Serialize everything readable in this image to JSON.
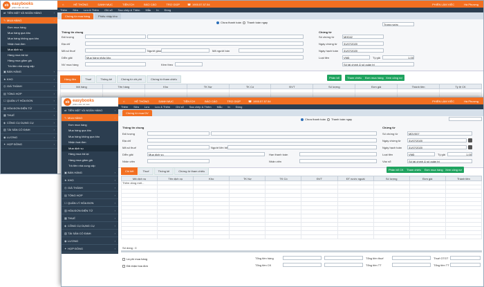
{
  "brand": {
    "logo_letters": "eb",
    "name": "easybooks",
    "tagline": "phần mềm kế toán"
  },
  "topmenu": {
    "items": [
      "HỆ THỐNG",
      "DANH MỤC",
      "TIỆN ÍCH",
      "BÁO CÁO",
      "TRỢ GIÚP"
    ],
    "phone": "1900.57.57.54",
    "session": "PHIÊN LÀM VIỆC",
    "user": "Hà Phương"
  },
  "sidebar": {
    "items": [
      {
        "label": "TIỀN MẶT VÀ NGÂN HÀNG"
      },
      {
        "label": "MUA HÀNG",
        "active": true
      },
      {
        "label": "BÁN HÀNG"
      },
      {
        "label": "KHO"
      },
      {
        "label": "GIÁ THÀNH"
      },
      {
        "label": "TỔNG HỢP"
      },
      {
        "label": "QUẢN LÝ HÓA ĐƠN"
      },
      {
        "label": "HÓA ĐƠN ĐIỆN TỬ"
      },
      {
        "label": "THUẾ"
      },
      {
        "label": "CÔNG CỤ DỤNG CỤ"
      },
      {
        "label": "TÀI SẢN CỐ ĐỊNH"
      },
      {
        "label": "LƯƠNG"
      },
      {
        "label": "HỢP ĐỒNG"
      }
    ],
    "sub": [
      "Đơn mua hàng",
      "Mua hàng qua kho",
      "Mua hàng không qua kho",
      "Nhận hoá đơn",
      "Mua dịch vụ",
      "Hàng mua trả lại",
      "Hàng mua giảm giá",
      "Trả tiền nhà cung cấp"
    ]
  },
  "w1": {
    "toolbar": [
      "Thêm",
      "Sửa",
      "Lưu & Thêm",
      "Ghi sổ",
      "Sao chép & Thêm",
      "Mẫu",
      "In",
      "Đóng"
    ],
    "tabs": [
      "Chứng từ mua hàng",
      "Phiếu nhập kho"
    ],
    "radios": [
      "Chưa thanh toán",
      "Thanh toán ngay"
    ],
    "form": {
      "title": "Thông tin chung",
      "labels": [
        "Đối tượng",
        "Địa chỉ",
        "Mã số thuế",
        "Diễn giải",
        "NV mua hàng"
      ],
      "contact": "Người giao",
      "person": "Kèm theo",
      "desc": "Mua hàng nhập kho",
      "vat": "Mã người bán"
    },
    "voucher": {
      "title": "Chứng từ",
      "fields": [
        {
          "label": "Số chứng từ",
          "value": "MH042"
        },
        {
          "label": "Ngày chứng từ",
          "value": "31/07/2020"
        },
        {
          "label": "Ngày hạch toán",
          "value": "31/07/2020"
        }
      ],
      "currency_label": "Loại tiền",
      "currency": "VNĐ",
      "rate_label": "Tỷ giá",
      "rate": "1.00",
      "doc_type": "Trong nước",
      "debt": "Số tài chính & số quản trị"
    },
    "dtabs": [
      "Hàng tiền",
      "Thuế",
      "Thống kê",
      "Chứng từ chi phí",
      "Chứng từ tham chiếu"
    ],
    "buttons": [
      "Phân bổ",
      "Tham chiếu",
      "Đơn mua hàng",
      "Xem công nợ"
    ],
    "cols": [
      "Mã hàng",
      "Tên hàng",
      "Kho",
      "TK Nợ",
      "TK Có",
      "ĐVT",
      "Số lượng",
      "Đơn giá",
      "Thành tiền",
      "Tỷ lệ CK"
    ]
  },
  "w2": {
    "toolbar": [
      "Thêm",
      "Sửa",
      "Lưu",
      "Lưu & Thêm",
      "Ghi sổ",
      "Sao chép & Thêm",
      "Mẫu",
      "In",
      "Đóng"
    ],
    "tabs": [
      "Chứng từ mua DV"
    ],
    "radios": [
      "Chưa thanh toán",
      "Thanh toán ngay"
    ],
    "form": {
      "title": "Thông tin chung",
      "labels": [
        "Đối tượng",
        "Địa chỉ",
        "Mã số thuế",
        "Diễn giải",
        "Nhân viên"
      ],
      "contact": "Người liên hệ",
      "desc": "Mua dịch vụ",
      "vat": "Hạn thanh toán",
      "bank": "Nhân viên"
    },
    "voucher": {
      "title": "Chứng từ",
      "fields": [
        {
          "label": "Số chứng từ",
          "value": "MDV007"
        },
        {
          "label": "Ngày chứng từ",
          "value": "31/07/2020"
        },
        {
          "label": "Ngày hạch toán",
          "value": "31/07/2020"
        }
      ],
      "currency_label": "Loại tiền",
      "currency": "VNĐ",
      "rate_label": "Tỷ giá",
      "rate": "1.00",
      "doc_label": "Vào sổ",
      "debt": "Số tài chính & số quản trị"
    },
    "dtabs": [
      "Chi tiết",
      "Thuế",
      "Thống kê",
      "Chứng từ tham chiếu"
    ],
    "buttons": [
      "Phân bổ CK",
      "Tham chiếu",
      "Đơn mua hàng",
      "Xem công nợ"
    ],
    "cols": [
      "Mã dịch vụ",
      "Tên dịch vụ",
      "Kho",
      "TK Nợ",
      "TK Có",
      "ĐVT",
      "ĐT nước ngoài",
      "Số lượng",
      "Đơn giá",
      "Thành tiền"
    ],
    "row_placeholder": "Thêm dòng mới...",
    "row_count": "Số dòng : 0",
    "footer": {
      "checks": [
        "Là phí mua hàng",
        "Đã nhận hóa đơn"
      ],
      "totals": [
        {
          "label": "Tổng tiền hàng",
          "value": ""
        },
        {
          "label": "Tổng tiền CK",
          "value": ""
        }
      ],
      "totals2": [
        {
          "label": "Tổng tiền thuế",
          "value": ""
        },
        {
          "label": "Tổng tiền TT",
          "value": ""
        }
      ],
      "right": [
        {
          "label": "Thuế GTGT",
          "value": ""
        },
        {
          "label": "Tổng tiền TT",
          "value": ""
        }
      ]
    }
  },
  "colors": {
    "accent": "#f26f21",
    "sidebar": "#2c3e50",
    "green": "#1fa35f"
  }
}
